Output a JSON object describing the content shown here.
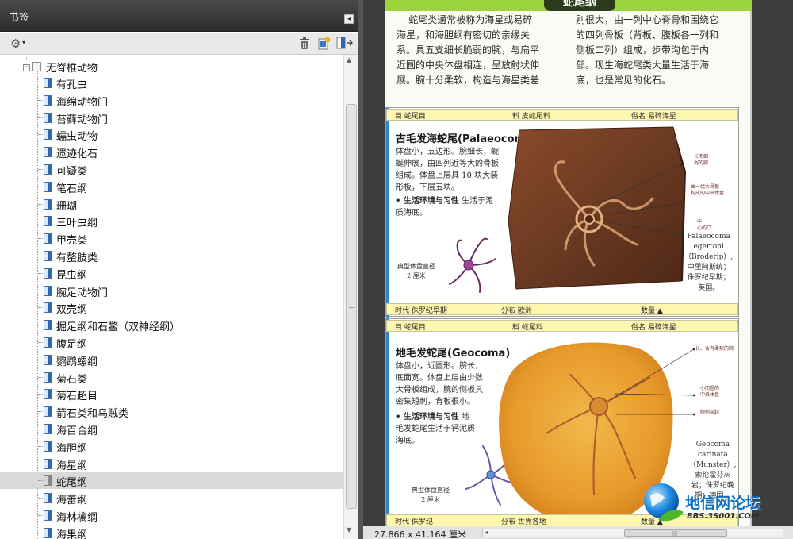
{
  "bookmarks_panel": {
    "title": "书签",
    "root": {
      "label": "无脊椎动物",
      "expanded": true
    },
    "items": [
      {
        "label": "有孔虫"
      },
      {
        "label": "海绵动物门"
      },
      {
        "label": "苔藓动物门"
      },
      {
        "label": "蠕虫动物"
      },
      {
        "label": "遗迹化石"
      },
      {
        "label": "可疑类"
      },
      {
        "label": "笔石纲"
      },
      {
        "label": "珊瑚"
      },
      {
        "label": "三叶虫纲"
      },
      {
        "label": "甲壳类"
      },
      {
        "label": "有螯肢类"
      },
      {
        "label": "昆虫纲"
      },
      {
        "label": "腕足动物门"
      },
      {
        "label": "双壳纲"
      },
      {
        "label": "掘足纲和石鳖（双神经纲）"
      },
      {
        "label": "腹足纲"
      },
      {
        "label": "鹦鹉螺纲"
      },
      {
        "label": "菊石类"
      },
      {
        "label": "菊石超目"
      },
      {
        "label": "箭石类和乌贼类"
      },
      {
        "label": "海百合纲"
      },
      {
        "label": "海胆纲"
      },
      {
        "label": "海星纲"
      },
      {
        "label": "蛇尾纲"
      },
      {
        "label": "海蕾纲"
      },
      {
        "label": "海林檎纲"
      },
      {
        "label": "海果纲"
      }
    ],
    "selected_index": 23,
    "toolbar_icons": [
      "gear-icon",
      "trash-icon",
      "new-bookmark-icon",
      "expand-bookmark-icon"
    ]
  },
  "document": {
    "banner_title": "蛇尾纲",
    "intro_left": "    蛇尾类通常被称为海星或易碎\n海星，和海胆纲有密切的亲缘关\n系。具五支细长脆弱的腕，与扁平\n近圆的中央体盘相连，呈放射状伸\n展。腕十分柔软，构造与海星类差",
    "intro_right": "别很大，由一列中心脊骨和围绕它\n的四列骨板（背板、腹板各一列和\n侧板二列）组成，步带沟包于内\n部。现生海蛇尾类大量生活于海\n底，也是常见的化石。",
    "cards": [
      {
        "top_bar": {
          "order": "目  蛇尾目",
          "family": "科  皮蛇尾科",
          "alias": "俗名  易碎海星"
        },
        "title": "古毛发海蛇尾(Palaeocoma)",
        "body": "体盘小，五边形。腕细长，蜿\n蜒伸展，由四列近等大的骨板\n组成。体盘上层具 10 块大装\n形板，下层五块。",
        "env_label": "• 生活环境与习性",
        "env_text": "生活于泥\n质海底。",
        "diagram_note": "典型体盘直径\n2 厘米",
        "sci_name": "Palaeocoma\negertoni\n（Broderip）;\n中里阿斯统；\n侏罗纪早期；\n英国。",
        "callouts": [
          "长而细\n弱的腕",
          "由一组大骨板\n构成的中央体盘",
          "中\n心的口"
        ],
        "bottom_bar": {
          "age": "时代  侏罗纪早期",
          "distribution": "分布  欧洲",
          "count": "数量  ▲"
        }
      },
      {
        "top_bar": {
          "order": "目  蛇尾目",
          "family": "科  蛇尾科",
          "alias": "俗名  易碎海星"
        },
        "title": "地毛发蛇尾(Geocoma)",
        "body": "体盘小，近圆形。腕长，\n底面宽。体盘上层由少数\n大骨板组成，腕的侧板具\n密集短刺，背板很小。",
        "env_label": "• 生活环境与习性",
        "env_text": "地\n毛发蛇尾生活于钙泥质\n海底。",
        "diagram_note": "典型体盘直径\n2 厘米",
        "sci_name": "Geocoma\ncarinata\n（Munster）;\n索伦霍芬灰\n岩；侏罗纪晚\n期；德国。",
        "callouts": [
          "长、含有柔软的腕",
          "小而圆的\n中央体盘",
          "腕侧突起"
        ],
        "bottom_bar": {
          "age": "时代  侏罗纪",
          "distribution": "分布  世界各地",
          "count": "数量  ▲"
        }
      }
    ]
  },
  "status_bar": {
    "page_size": "27.866 x 41.164 厘米"
  },
  "watermark": {
    "name": "地信网论坛",
    "url": "BBS.3S001.COM"
  },
  "colors": {
    "banner_green": "#9cd23e",
    "card_bar_yellow": "#fff6b0",
    "fossil_brown": "#6b3a22",
    "fossil_orange": "#e8a030",
    "selection": "#d9d9d9"
  }
}
